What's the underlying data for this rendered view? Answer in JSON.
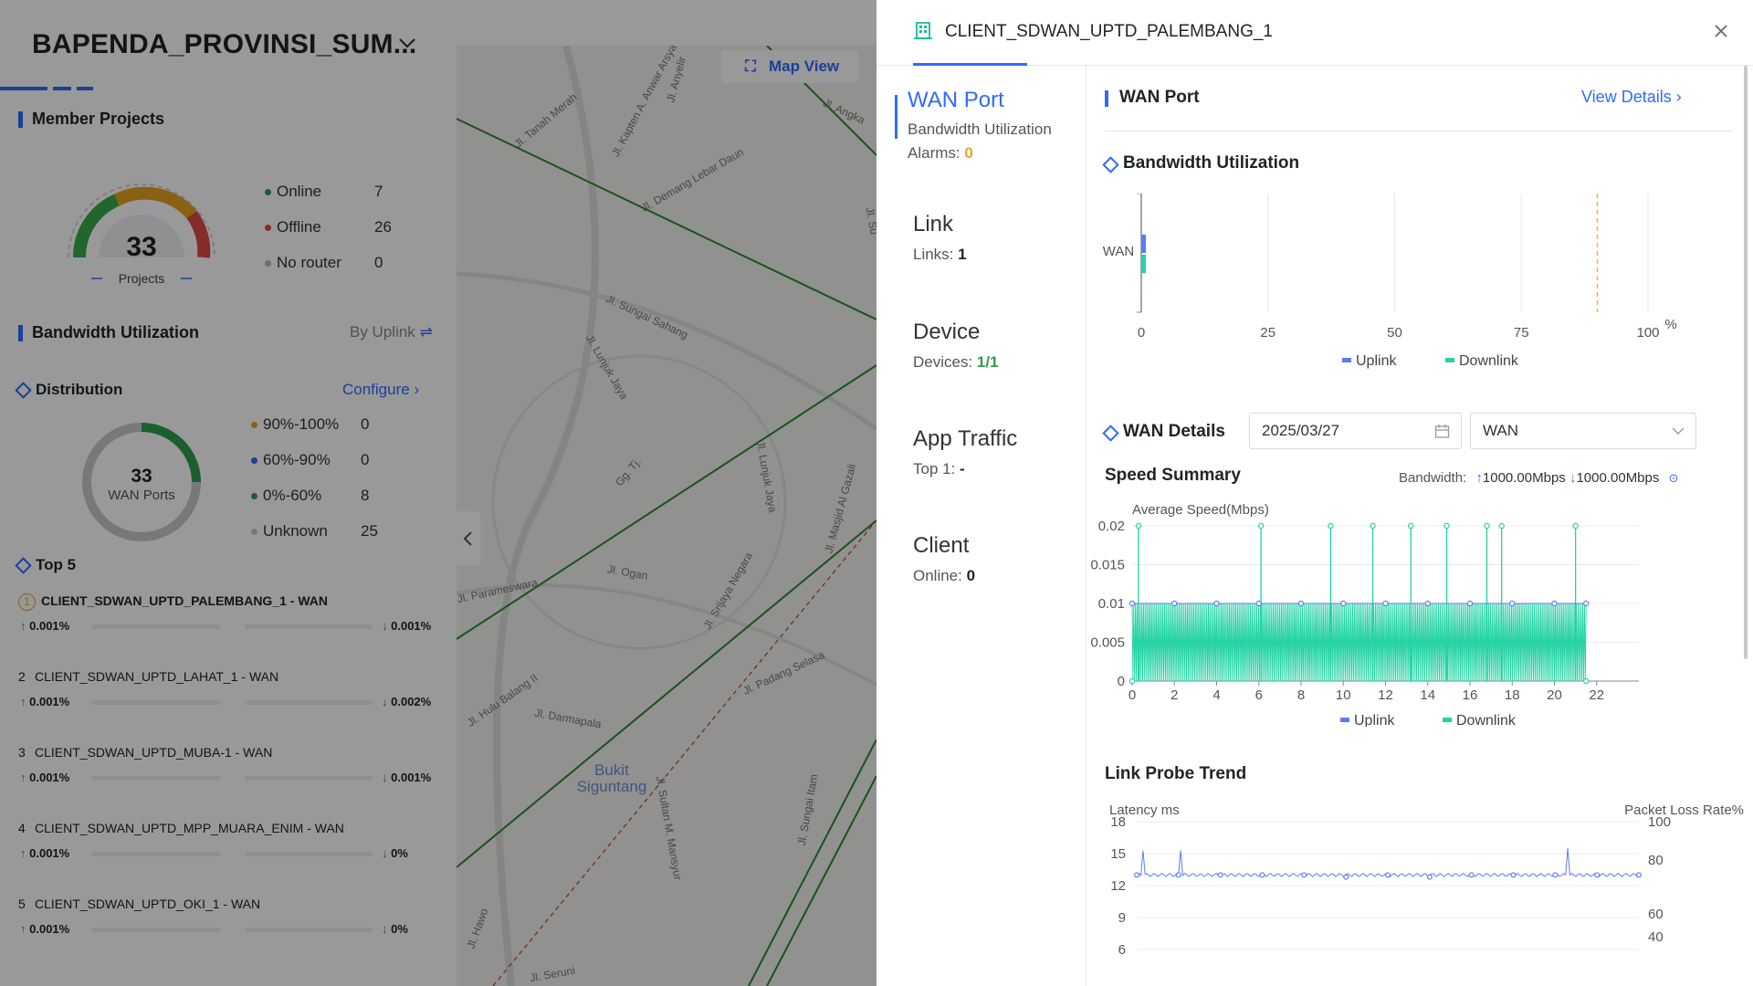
{
  "dashboard": {
    "project_name": "BAPENDA_PROVINSI_SUM...",
    "member_projects": {
      "title": "Member Projects",
      "total": "33",
      "gauge_label": "Projects",
      "legend": [
        {
          "label": "Online",
          "value": "7",
          "color": "#2e9e4f"
        },
        {
          "label": "Offline",
          "value": "26",
          "color": "#e04848"
        },
        {
          "label": "No router",
          "value": "0",
          "color": "#b8b8b8"
        }
      ]
    },
    "bandwidth": {
      "title": "Bandwidth Utilization",
      "by_uplink": "By Uplink",
      "distribution_title": "Distribution",
      "configure": "Configure",
      "donut_value": "33",
      "donut_label": "WAN Ports",
      "legend": [
        {
          "label": "90%-100%",
          "value": "0",
          "color": "#f0a020"
        },
        {
          "label": "60%-90%",
          "value": "0",
          "color": "#2f6bff"
        },
        {
          "label": "0%-60%",
          "value": "8",
          "color": "#2e9e4f"
        },
        {
          "label": "Unknown",
          "value": "25",
          "color": "#c8c8c8"
        }
      ],
      "top5_title": "Top 5",
      "top5": [
        {
          "rank": "1",
          "name": "CLIENT_SDWAN_UPTD_PALEMBANG_1 - WAN",
          "up": "0.001%",
          "down": "0.001%"
        },
        {
          "rank": "2",
          "name": "CLIENT_SDWAN_UPTD_LAHAT_1 - WAN",
          "up": "0.001%",
          "down": "0.002%"
        },
        {
          "rank": "3",
          "name": "CLIENT_SDWAN_UPTD_MUBA-1 - WAN",
          "up": "0.001%",
          "down": "0.001%"
        },
        {
          "rank": "4",
          "name": "CLIENT_SDWAN_UPTD_MPP_MUARA_ENIM - WAN",
          "up": "0.001%",
          "down": "0%"
        },
        {
          "rank": "5",
          "name": "CLIENT_SDWAN_UPTD_OKI_1 - WAN",
          "up": "0.001%",
          "down": "0%"
        }
      ]
    },
    "map": {
      "view_button": "Map View",
      "labels": [
        "Jl. Tanah Merah",
        "Jl. Kapten A. Anwar Arsyad",
        "Jl. Anyelir",
        "Jl. Angka",
        "Jl. Demang Lebar Daun",
        "Jl. Sungai Sahang",
        "Jl. Lunjuk Jaya",
        "Gg. Tj.",
        "Jl. Parameswara",
        "Jl. Ogan",
        "Jl. Srijaya Negara",
        "Jl. Lunjuk Jaya",
        "Jl. Masjid Al Gazali",
        "Jl. Hulu Balang II",
        "Jl. Darmapala",
        "Jl. Padang Selasa",
        "Bukit Siguntang",
        "Jl. Sultan M. Mansyur",
        "Jl. Sungai Itam",
        "Jl. Seruni",
        "Jl. Hawo",
        "Jl. Su"
      ]
    }
  },
  "drawer": {
    "title": "CLIENT_SDWAN_UPTD_PALEMBANG_1",
    "nav": [
      {
        "title": "WAN Port",
        "line1": "Bandwidth Utilization",
        "line2_label": "Alarms: ",
        "line2_value": "0"
      },
      {
        "title": "Link",
        "label": "Links: ",
        "value": "1"
      },
      {
        "title": "Device",
        "label": "Devices: ",
        "value": "1/1"
      },
      {
        "title": "App Traffic",
        "label": "Top 1: ",
        "value": "-"
      },
      {
        "title": "Client",
        "label": "Online: ",
        "value": "0"
      }
    ],
    "section_title": "WAN Port",
    "view_details": "View Details",
    "bw_title": "Bandwidth Utilization",
    "wan_details_title": "WAN Details",
    "date_value": "2025/03/27",
    "wan_select": "WAN",
    "speed_summary_title": "Speed Summary",
    "bandwidth_label": "Bandwidth:",
    "bandwidth_up": "1000.00Mbps",
    "bandwidth_down": "1000.00Mbps",
    "link_probe_title": "Link Probe Trend",
    "colors": {
      "uplink": "#5b7cf0",
      "downlink": "#25d3a4",
      "threshold": "#f0b030",
      "accent": "#2f6bff"
    }
  },
  "chart_data": [
    {
      "type": "bar",
      "orientation": "horizontal",
      "title": "Bandwidth Utilization",
      "categories": [
        "WAN"
      ],
      "series": [
        {
          "name": "Uplink",
          "values": [
            0.001
          ]
        },
        {
          "name": "Downlink",
          "values": [
            0.001
          ]
        }
      ],
      "xlim": [
        0,
        100
      ],
      "xticks": [
        "0",
        "25",
        "50",
        "75",
        "100"
      ],
      "x_unit": "%",
      "threshold": 90,
      "grid": true,
      "legend": "bottom"
    },
    {
      "type": "line",
      "title": "Speed Summary",
      "ylabel": "Average Speed(Mbps)",
      "ylim": [
        0,
        0.02
      ],
      "yticks": [
        "0",
        "0.005",
        "0.01",
        "0.015",
        "0.02"
      ],
      "xlim": [
        0,
        24
      ],
      "xticks": [
        "0",
        "2",
        "4",
        "6",
        "8",
        "10",
        "12",
        "14",
        "16",
        "18",
        "20",
        "22"
      ],
      "series": [
        {
          "name": "Uplink",
          "x": [
            0,
            2,
            4,
            6,
            8,
            10,
            12,
            14,
            16,
            18,
            20,
            21.5
          ],
          "values": [
            0.01,
            0.01,
            0.01,
            0.01,
            0.01,
            0.01,
            0.01,
            0.01,
            0.01,
            0.01,
            0.01,
            0.01
          ]
        },
        {
          "name": "Downlink",
          "x": [
            0,
            0.3,
            2,
            4,
            6,
            6.1,
            8,
            9.4,
            10,
            11.4,
            12,
            13.2,
            14,
            14.9,
            16,
            16.8,
            17.5,
            18,
            20,
            21,
            21.5
          ],
          "values": [
            0,
            0.02,
            0.01,
            0.01,
            0.01,
            0.02,
            0.01,
            0.02,
            0.01,
            0.02,
            0.01,
            0.02,
            0.01,
            0.02,
            0.01,
            0.02,
            0.02,
            0.01,
            0.01,
            0.02,
            0
          ]
        }
      ],
      "legend": "bottom"
    },
    {
      "type": "line",
      "title": "Link Probe Trend",
      "ylabel": "Latency ms",
      "y2label": "Packet Loss Rate%",
      "yticks": [
        "18",
        "15",
        "12",
        "9",
        "6"
      ],
      "y2ticks": [
        "100",
        "80",
        "60",
        "40"
      ],
      "ylim": [
        5,
        18
      ],
      "series": [
        {
          "name": "Latency",
          "x": [
            0,
            0.3,
            2,
            2.1,
            4,
            6,
            8,
            10,
            12,
            14,
            16,
            18,
            20,
            20.6,
            22,
            24
          ],
          "values": [
            13,
            15.3,
            13,
            15.3,
            13,
            13,
            13,
            12.8,
            13,
            12.8,
            13,
            13,
            13,
            15.5,
            13,
            13
          ]
        }
      ]
    }
  ]
}
